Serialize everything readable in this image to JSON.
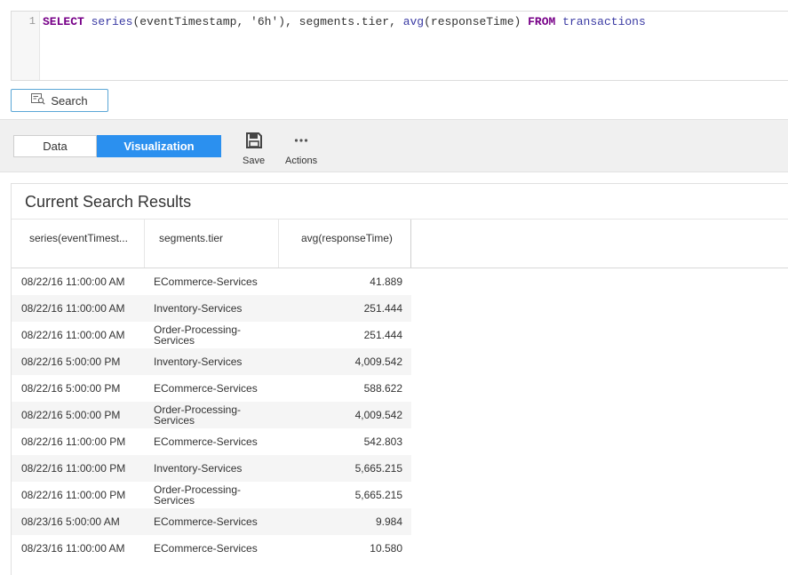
{
  "editor": {
    "line_number": "1",
    "tokens": {
      "select": "SELECT",
      "series": "series",
      "series_args": "(eventTimestamp, '6h'), segments.tier, ",
      "avg": "avg",
      "avg_args": "(responseTime) ",
      "from": "FROM",
      "space": " ",
      "table": "transactions"
    }
  },
  "search": {
    "label": "Search",
    "icon": "search-query-icon"
  },
  "tabs": {
    "data": "Data",
    "visualization": "Visualization",
    "active": "Visualization",
    "active_color": "#2b90ef"
  },
  "toolbar": {
    "save": {
      "label": "Save",
      "icon": "save-icon"
    },
    "actions": {
      "label": "Actions",
      "icon": "ellipsis-icon"
    }
  },
  "results": {
    "title": "Current Search Results",
    "columns": [
      "series(eventTimest...",
      "segments.tier",
      "avg(responseTime)"
    ],
    "rows": [
      [
        "08/22/16 11:00:00 AM",
        "ECommerce-Services",
        "41.889"
      ],
      [
        "08/22/16 11:00:00 AM",
        "Inventory-Services",
        "251.444"
      ],
      [
        "08/22/16 11:00:00 AM",
        "Order-Processing-Services",
        "251.444"
      ],
      [
        "08/22/16 5:00:00 PM",
        "Inventory-Services",
        "4,009.542"
      ],
      [
        "08/22/16 5:00:00 PM",
        "ECommerce-Services",
        "588.622"
      ],
      [
        "08/22/16 5:00:00 PM",
        "Order-Processing-Services",
        "4,009.542"
      ],
      [
        "08/22/16 11:00:00 PM",
        "ECommerce-Services",
        "542.803"
      ],
      [
        "08/22/16 11:00:00 PM",
        "Inventory-Services",
        "5,665.215"
      ],
      [
        "08/22/16 11:00:00 PM",
        "Order-Processing-Services",
        "5,665.215"
      ],
      [
        "08/23/16 5:00:00 AM",
        "ECommerce-Services",
        "9.984"
      ],
      [
        "08/23/16 11:00:00 AM",
        "ECommerce-Services",
        "10.580"
      ]
    ]
  }
}
